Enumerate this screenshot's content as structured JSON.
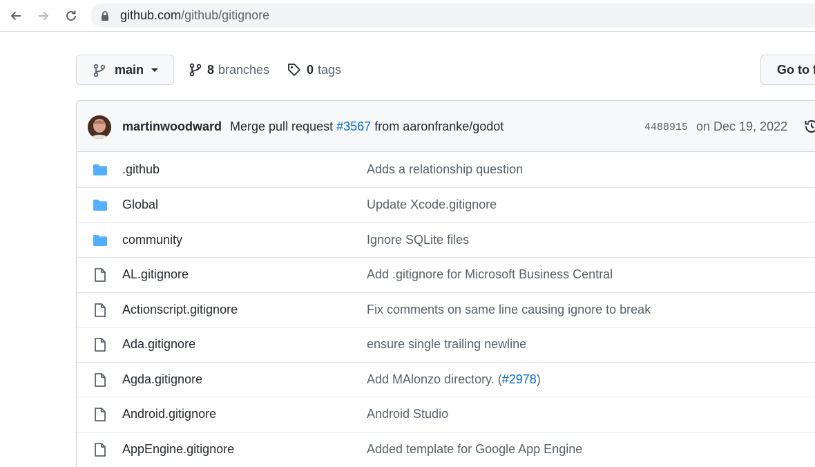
{
  "browser": {
    "url_host": "github.com",
    "url_path": "/github/gitignore"
  },
  "repo_bar": {
    "branch": "main",
    "branches_count": "8",
    "branches_label": "branches",
    "tags_count": "0",
    "tags_label": "tags",
    "goto_label": "Go to file"
  },
  "latest_commit": {
    "author": "martinwoodward",
    "message_prefix": "Merge pull request",
    "pr_link": "#3567",
    "message_suffix": "from aaronfranke/godot",
    "sha": "4488915",
    "date": "on Dec 19, 2022"
  },
  "files": [
    {
      "type": "folder",
      "name": ".github",
      "message": "Adds a relationship question"
    },
    {
      "type": "folder",
      "name": "Global",
      "message": "Update Xcode.gitignore"
    },
    {
      "type": "folder",
      "name": "community",
      "message": "Ignore SQLite files"
    },
    {
      "type": "file",
      "name": "AL.gitignore",
      "message": "Add .gitignore for Microsoft Business Central"
    },
    {
      "type": "file",
      "name": "Actionscript.gitignore",
      "message": "Fix comments on same line causing ignore to break"
    },
    {
      "type": "file",
      "name": "Ada.gitignore",
      "message": "ensure single trailing newline"
    },
    {
      "type": "file",
      "name": "Agda.gitignore",
      "message": "Add MAlonzo directory. (",
      "message_link": "#2978",
      "message_end": ")"
    },
    {
      "type": "file",
      "name": "Android.gitignore",
      "message": "Android Studio"
    },
    {
      "type": "file",
      "name": "AppEngine.gitignore",
      "message": "Added template for Google App Engine"
    }
  ],
  "colors": {
    "link": "#0969da",
    "folder": "#54aeff",
    "muted": "#57606a"
  }
}
